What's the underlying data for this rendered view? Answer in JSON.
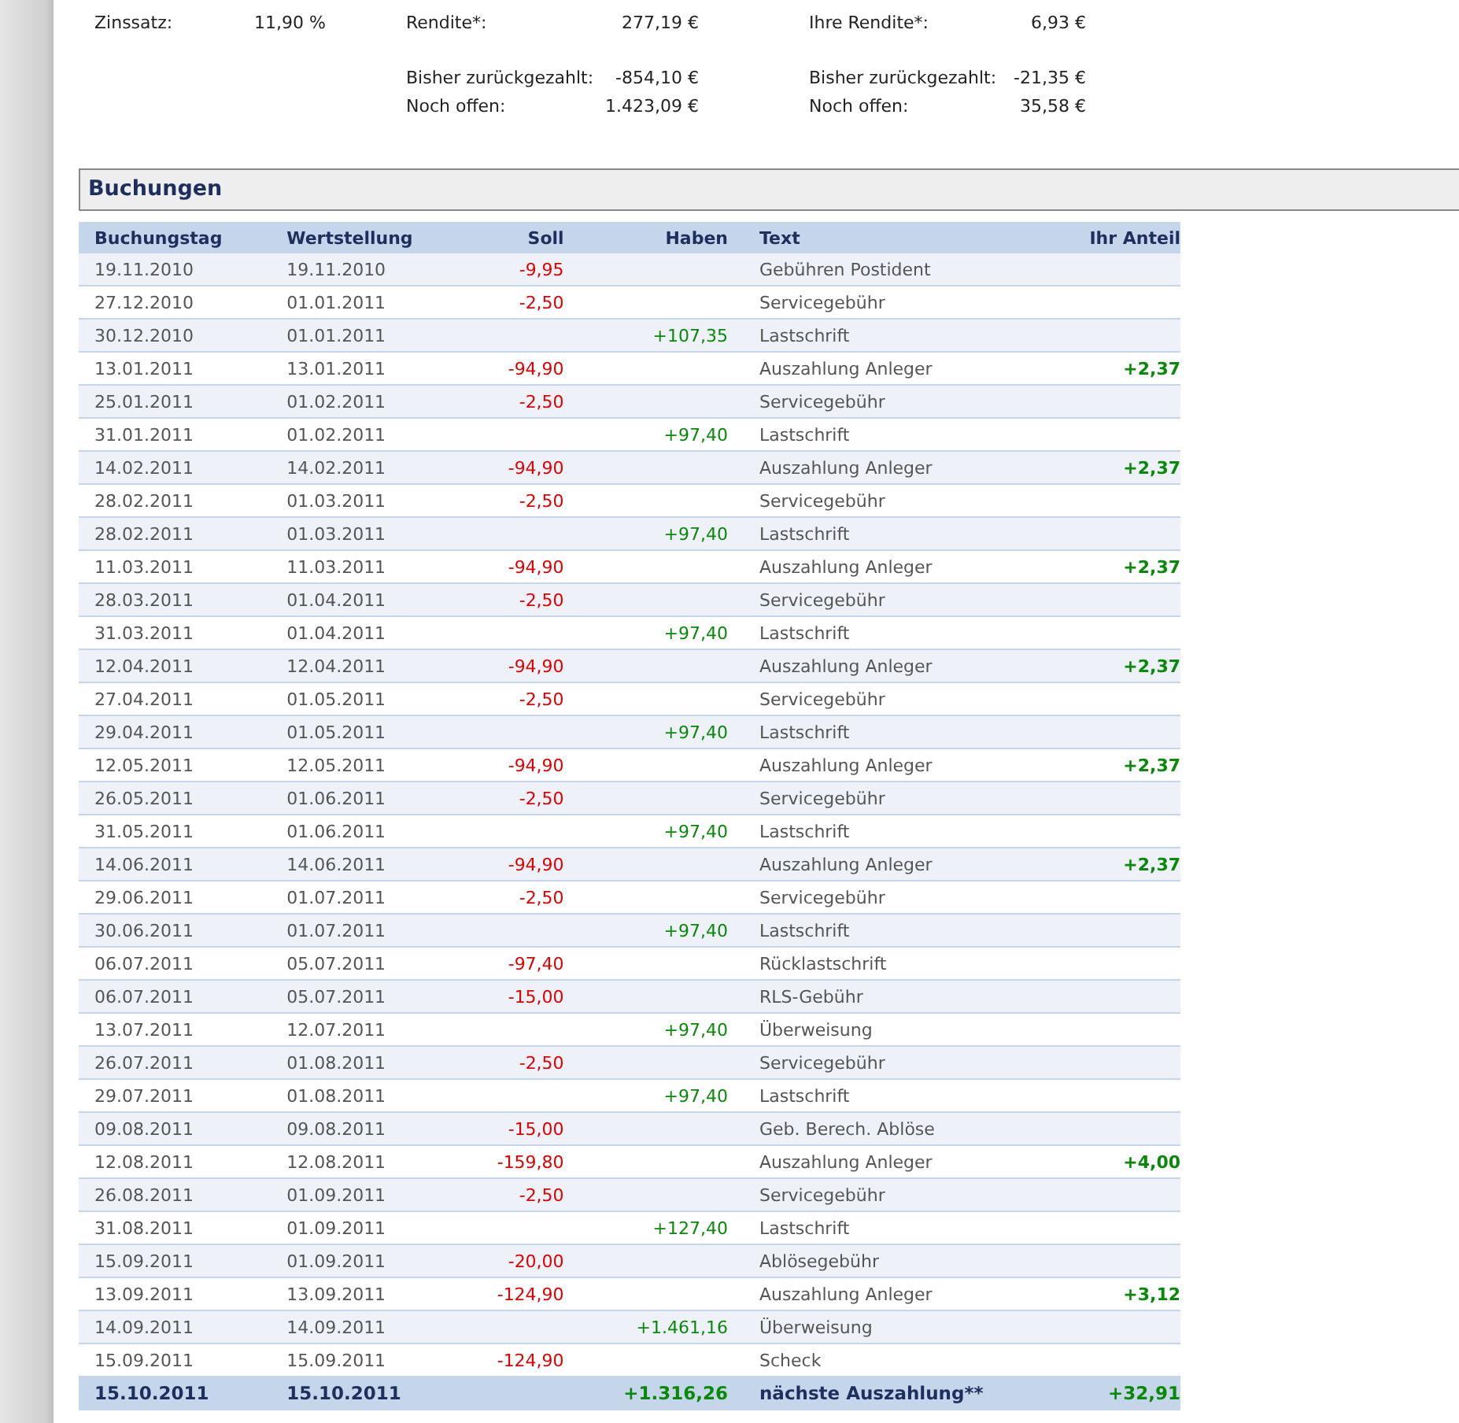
{
  "summary": [
    {
      "items": [
        {
          "label": "Zinssatz:",
          "value": "11,90 %"
        }
      ]
    },
    {
      "items": [
        {
          "label": "Rendite*:",
          "value": "277,19 €"
        },
        {
          "label": "Bisher zurückgezahlt:",
          "value": "-854,10 €",
          "gap": true
        },
        {
          "label": "Noch offen:",
          "value": "1.423,09 €"
        }
      ]
    },
    {
      "items": [
        {
          "label": "Ihre Rendite*:",
          "value": "6,93 €"
        },
        {
          "label": "Bisher zurückgezahlt:",
          "value": "-21,35 €",
          "gap": true
        },
        {
          "label": "Noch offen:",
          "value": "35,58 €"
        }
      ]
    }
  ],
  "section": {
    "title": "Buchungen"
  },
  "table": {
    "columns": [
      "Buchungstag",
      "Wertstellung",
      "Soll",
      "Haben",
      "Text",
      "Ihr Anteil"
    ],
    "rows": [
      {
        "kind": "entry",
        "booking": "19.11.2010",
        "value_date": "19.11.2010",
        "debit": "-9,95",
        "text": "Gebühren Postident"
      },
      {
        "kind": "entry",
        "booking": "27.12.2010",
        "value_date": "01.01.2011",
        "debit": "-2,50",
        "text": "Servicegebühr"
      },
      {
        "kind": "entry",
        "booking": "30.12.2010",
        "value_date": "01.01.2011",
        "credit": "+107,35",
        "text": "Lastschrift"
      },
      {
        "kind": "entry",
        "booking": "13.01.2011",
        "value_date": "13.01.2011",
        "debit": "-94,90",
        "text": "Auszahlung Anleger",
        "share": "+2,37"
      },
      {
        "kind": "entry",
        "booking": "25.01.2011",
        "value_date": "01.02.2011",
        "debit": "-2,50",
        "text": "Servicegebühr"
      },
      {
        "kind": "entry",
        "booking": "31.01.2011",
        "value_date": "01.02.2011",
        "credit": "+97,40",
        "text": "Lastschrift"
      },
      {
        "kind": "entry",
        "booking": "14.02.2011",
        "value_date": "14.02.2011",
        "debit": "-94,90",
        "text": "Auszahlung Anleger",
        "share": "+2,37"
      },
      {
        "kind": "entry",
        "booking": "28.02.2011",
        "value_date": "01.03.2011",
        "debit": "-2,50",
        "text": "Servicegebühr"
      },
      {
        "kind": "entry",
        "booking": "28.02.2011",
        "value_date": "01.03.2011",
        "credit": "+97,40",
        "text": "Lastschrift"
      },
      {
        "kind": "entry",
        "booking": "11.03.2011",
        "value_date": "11.03.2011",
        "debit": "-94,90",
        "text": "Auszahlung Anleger",
        "share": "+2,37"
      },
      {
        "kind": "entry",
        "booking": "28.03.2011",
        "value_date": "01.04.2011",
        "debit": "-2,50",
        "text": "Servicegebühr"
      },
      {
        "kind": "entry",
        "booking": "31.03.2011",
        "value_date": "01.04.2011",
        "credit": "+97,40",
        "text": "Lastschrift"
      },
      {
        "kind": "entry",
        "booking": "12.04.2011",
        "value_date": "12.04.2011",
        "debit": "-94,90",
        "text": "Auszahlung Anleger",
        "share": "+2,37"
      },
      {
        "kind": "entry",
        "booking": "27.04.2011",
        "value_date": "01.05.2011",
        "debit": "-2,50",
        "text": "Servicegebühr"
      },
      {
        "kind": "entry",
        "booking": "29.04.2011",
        "value_date": "01.05.2011",
        "credit": "+97,40",
        "text": "Lastschrift"
      },
      {
        "kind": "entry",
        "booking": "12.05.2011",
        "value_date": "12.05.2011",
        "debit": "-94,90",
        "text": "Auszahlung Anleger",
        "share": "+2,37"
      },
      {
        "kind": "entry",
        "booking": "26.05.2011",
        "value_date": "01.06.2011",
        "debit": "-2,50",
        "text": "Servicegebühr"
      },
      {
        "kind": "entry",
        "booking": "31.05.2011",
        "value_date": "01.06.2011",
        "credit": "+97,40",
        "text": "Lastschrift"
      },
      {
        "kind": "entry",
        "booking": "14.06.2011",
        "value_date": "14.06.2011",
        "debit": "-94,90",
        "text": "Auszahlung Anleger",
        "share": "+2,37"
      },
      {
        "kind": "entry",
        "booking": "29.06.2011",
        "value_date": "01.07.2011",
        "debit": "-2,50",
        "text": "Servicegebühr"
      },
      {
        "kind": "entry",
        "booking": "30.06.2011",
        "value_date": "01.07.2011",
        "credit": "+97,40",
        "text": "Lastschrift"
      },
      {
        "kind": "entry",
        "booking": "06.07.2011",
        "value_date": "05.07.2011",
        "debit": "-97,40",
        "text": "Rücklastschrift"
      },
      {
        "kind": "entry",
        "booking": "06.07.2011",
        "value_date": "05.07.2011",
        "debit": "-15,00",
        "text": "RLS-Gebühr"
      },
      {
        "kind": "entry",
        "booking": "13.07.2011",
        "value_date": "12.07.2011",
        "credit": "+97,40",
        "text": "Überweisung"
      },
      {
        "kind": "entry",
        "booking": "26.07.2011",
        "value_date": "01.08.2011",
        "debit": "-2,50",
        "text": "Servicegebühr"
      },
      {
        "kind": "entry",
        "booking": "29.07.2011",
        "value_date": "01.08.2011",
        "credit": "+97,40",
        "text": "Lastschrift"
      },
      {
        "kind": "entry",
        "booking": "09.08.2011",
        "value_date": "09.08.2011",
        "debit": "-15,00",
        "text": "Geb. Berech. Ablöse"
      },
      {
        "kind": "entry",
        "booking": "12.08.2011",
        "value_date": "12.08.2011",
        "debit": "-159,80",
        "text": "Auszahlung Anleger",
        "share": "+4,00"
      },
      {
        "kind": "entry",
        "booking": "26.08.2011",
        "value_date": "01.09.2011",
        "debit": "-2,50",
        "text": "Servicegebühr"
      },
      {
        "kind": "entry",
        "booking": "31.08.2011",
        "value_date": "01.09.2011",
        "credit": "+127,40",
        "text": "Lastschrift"
      },
      {
        "kind": "entry",
        "booking": "15.09.2011",
        "value_date": "01.09.2011",
        "debit": "-20,00",
        "text": "Ablösegebühr"
      },
      {
        "kind": "entry",
        "booking": "13.09.2011",
        "value_date": "13.09.2011",
        "debit": "-124,90",
        "text": "Auszahlung Anleger",
        "share": "+3,12"
      },
      {
        "kind": "entry",
        "booking": "14.09.2011",
        "value_date": "14.09.2011",
        "credit": "+1.461,16",
        "text": "Überweisung"
      },
      {
        "kind": "entry",
        "booking": "15.09.2011",
        "value_date": "15.09.2011",
        "debit": "-124,90",
        "text": "Scheck"
      },
      {
        "kind": "total",
        "booking": "15.10.2011",
        "value_date": "15.10.2011",
        "credit": "+1.316,26",
        "text": "nächste Auszahlung**",
        "share": "+32,91"
      }
    ]
  }
}
